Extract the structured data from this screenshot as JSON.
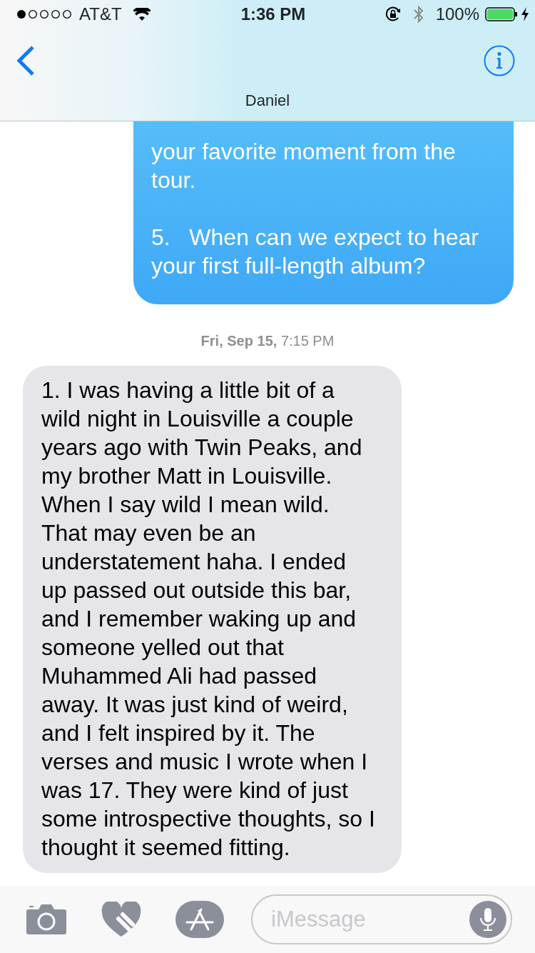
{
  "status_bar": {
    "carrier": "AT&T",
    "time": "1:36 PM",
    "battery": "100%"
  },
  "nav": {
    "title": "Daniel"
  },
  "messages": [
    {
      "kind": "sent",
      "text": "your favorite moment from the tour.\n\n5.\tWhen can we expect to hear your first full-length album?"
    },
    {
      "kind": "timestamp",
      "text": "**Fri, Sep 15,** 7:15 PM"
    },
    {
      "kind": "received",
      "text": "1. I was having a little bit of a wild night in Louisville a couple years ago with Twin Peaks, and my brother Matt in Louisville. When I say wild I mean wild. That may even be an understatement haha. I ended up passed out outside this bar, and I remember waking up and someone yelled out that Muhammed Ali had passed away. It was just kind of weird, and I felt inspired by it. The verses and music I wrote when I was 17. They were kind of just some introspective thoughts, so I thought it seemed fitting."
    }
  ],
  "composer": {
    "placeholder": "iMessage"
  }
}
